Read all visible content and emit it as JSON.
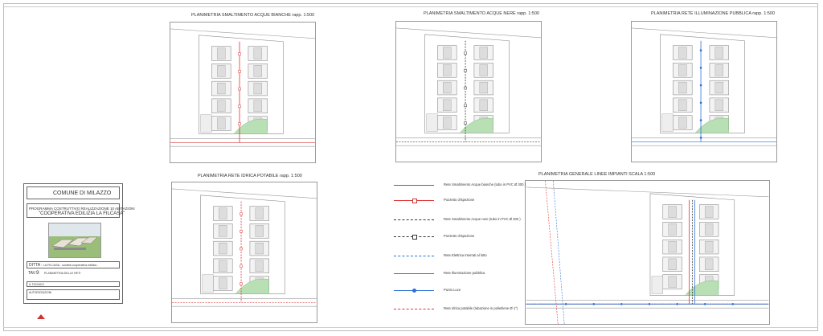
{
  "titles": {
    "p1": "PLANIMETRIA SMALTIMENTO ACQUE BIANCHE  rapp. 1:500",
    "p2": "PLANIMETRIA SMALTIMENTO ACQUE NERE  rapp. 1:500",
    "p3": "PLANIMETRIA RETE ILLUMINAZIONE PUBBLICA  rapp. 1:500",
    "p4": "PLANIMETRIA RETE IDRICA POTABILE  rapp. 1:500",
    "p5": "PLANIMETRIA GENERALE LINEE IMPIANTI  SCALA 1:500"
  },
  "legend": [
    {
      "label": "Rete Smaltimento Acque bianche (tubo in PVC Ø 300 )",
      "color": "#d33",
      "style": "solid"
    },
    {
      "label": "Pozzetto d'ispezione",
      "color": "#d33",
      "style": "pozzetto"
    },
    {
      "label": "Rete Smaltimento Acque nere (tubo in PVC Ø 300 )",
      "color": "#333",
      "style": "dashed"
    },
    {
      "label": "Pozzetto d'ispezione",
      "color": "#333",
      "style": "pozzetto-k"
    },
    {
      "label": "Rete Elettrica interrati al lotto",
      "color": "#2b6fd6",
      "style": "dashed"
    },
    {
      "label": "Rete Illuminazione pubblica",
      "color": "#2b6fd6",
      "style": "solid"
    },
    {
      "label": "Punto Luce",
      "color": "#2b6fd6",
      "style": "dot"
    },
    {
      "label": "Rete Idrica potabile (tubazione in polietilene Ø 1\")",
      "color": "#d33",
      "style": "dashed"
    }
  ],
  "titleblock": {
    "comune": "COMUNE DI MILAZZO",
    "programma": "PROGRAMMA COSTRUTTIVO REALIZZAZIONE 10 ABITAZIONI",
    "cooperativa": "\"COOPERATIVA EDILIZIA LA FILCASA\"",
    "ditta_label": "DITTA :",
    "ditta_value": "LA FILCASA - società cooperativa edilizia -",
    "tav_label": "TAV.",
    "tav_number": "9",
    "tav_desc": "PLANIMETRIA DELLE RETI",
    "tecnico": "IL TECNICO",
    "autorizzazioni": "AUTORIZZAZIONI"
  },
  "colors": {
    "red": "#d33",
    "blue": "#2b6fd6",
    "dark": "#333",
    "green": "#8fc98f"
  }
}
